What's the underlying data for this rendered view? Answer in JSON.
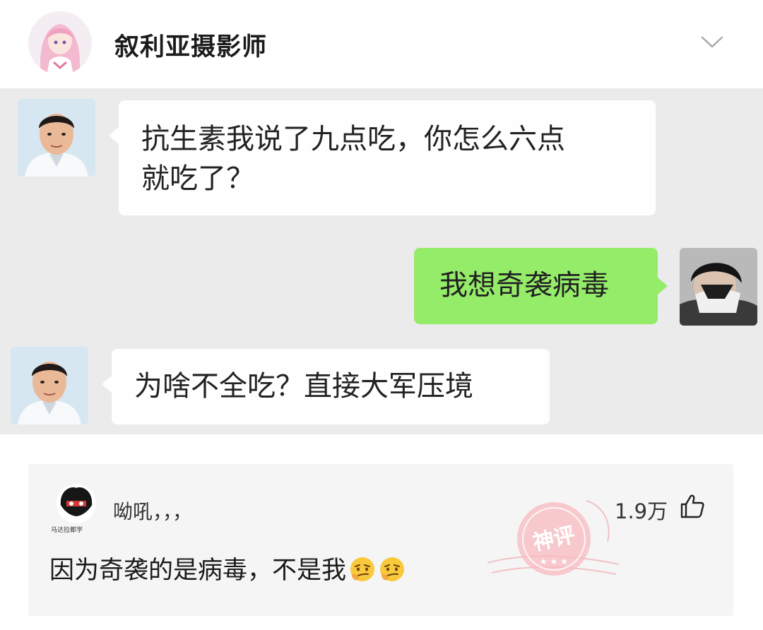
{
  "header": {
    "username": "叙利亚摄影师",
    "avatar_icon": "anime-avatar",
    "expand_icon": "chevron-down-icon"
  },
  "chat": {
    "messages": [
      {
        "side": "left",
        "lines": [
          "抗生素我说了九点吃，你怎么六点",
          "就吃了？"
        ]
      },
      {
        "side": "right",
        "lines": [
          "我想奇袭病毒"
        ]
      },
      {
        "side": "left",
        "lines": [
          "为啥不全吃？直接大军压境"
        ]
      }
    ],
    "colors": {
      "background": "#ebebeb",
      "left_bubble": "#fefefe",
      "right_bubble": "#95ec69"
    }
  },
  "comment": {
    "avatar_caption": "马达拉都学",
    "username": "呦吼，，，",
    "likes": "1.9万",
    "text": "因为奇袭的是病毒，不是我",
    "emojis": [
      "smirk-emoji",
      "smirk-emoji"
    ],
    "badge": "神评"
  }
}
